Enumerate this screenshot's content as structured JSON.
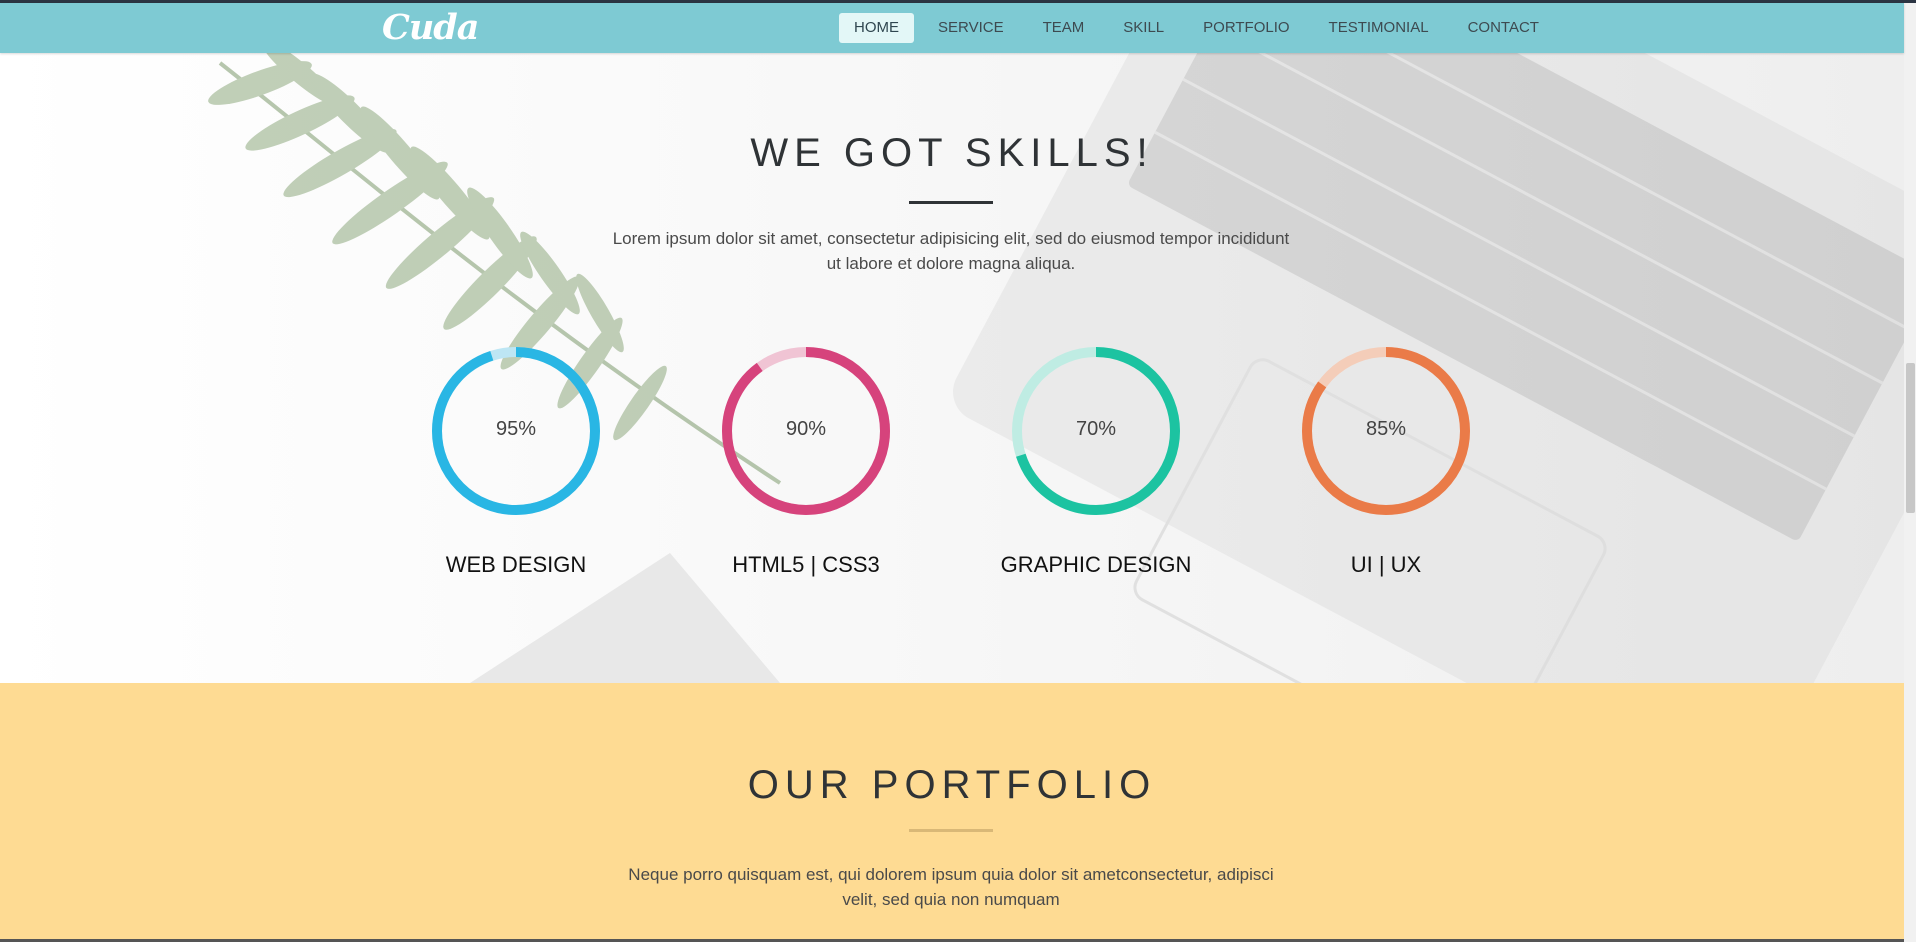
{
  "brand": {
    "logo": "Cuda"
  },
  "nav": {
    "items": [
      "HOME",
      "SERVICE",
      "TEAM",
      "SKILL",
      "PORTFOLIO",
      "TESTIMONIAL",
      "CONTACT"
    ],
    "active": "HOME"
  },
  "skills_section": {
    "title": "WE GOT SKILLS!",
    "description_line1": "Lorem ipsum dolor sit amet, consectetur adipisicing elit, sed do eiusmod tempor incididunt",
    "description_line2": "ut labore et dolore magna aliqua.",
    "skills": [
      {
        "name": "WEB DESIGN",
        "percent_label": "95%",
        "percent": 95,
        "color": "#29b6e4",
        "track": "#bde6f4"
      },
      {
        "name": "HTML5 | CSS3",
        "percent_label": "90%",
        "percent": 90,
        "color": "#d6437c",
        "track": "#f0c4d4"
      },
      {
        "name": "GRAPHIC DESIGN",
        "percent_label": "70%",
        "percent": 70,
        "color": "#1cc3a1",
        "track": "#bfece3"
      },
      {
        "name": "UI | UX",
        "percent_label": "85%",
        "percent": 85,
        "color": "#ea7b48",
        "track": "#f4cdb9"
      }
    ]
  },
  "portfolio_section": {
    "title": "OUR PORTFOLIO",
    "description_line1": "Neque porro quisquam est, qui dolorem ipsum quia dolor sit ametconsectetur, adipisci",
    "description_line2": "velit, sed quia non numquam"
  },
  "colors": {
    "navbar": "#7ecad3",
    "active_nav": "#e3f7f7",
    "skills_divider": "#2f3336",
    "portfolio_bg": "#fedb93",
    "portfolio_divider": "#d9b877"
  }
}
